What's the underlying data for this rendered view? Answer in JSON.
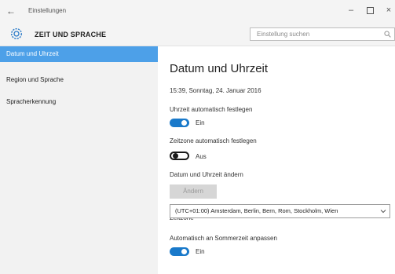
{
  "window": {
    "back_glyph": "←",
    "app_title": "Einstellungen",
    "minimize_glyph": "–",
    "close_glyph": "×"
  },
  "header": {
    "section_title": "ZEIT UND SPRACHE",
    "search_placeholder": "Einstellung suchen"
  },
  "sidebar": {
    "items": [
      {
        "label": "Datum und Uhrzeit",
        "active": true
      },
      {
        "label": "Region und Sprache",
        "active": false
      },
      {
        "label": "Spracherkennung",
        "active": false
      }
    ]
  },
  "main": {
    "title": "Datum und Uhrzeit",
    "datetime": "15:39, Sonntag, 24. Januar 2016",
    "auto_time": {
      "label": "Uhrzeit automatisch festlegen",
      "state": "Ein"
    },
    "auto_timezone": {
      "label": "Zeitzone automatisch festlegen",
      "state": "Aus"
    },
    "change_datetime": {
      "label": "Datum und Uhrzeit ändern",
      "button": "Ändern"
    },
    "timezone": {
      "label": "Zeitzone",
      "value": "(UTC+01:00) Amsterdam, Berlin, Bern, Rom, Stockholm, Wien"
    },
    "dst": {
      "label": "Automatisch an Sommerzeit anpassen",
      "state": "Ein"
    }
  },
  "colors": {
    "accent": "#1979ca",
    "sidebar_active": "#4da0e8",
    "sidebar_bg": "#f2f2f2"
  }
}
